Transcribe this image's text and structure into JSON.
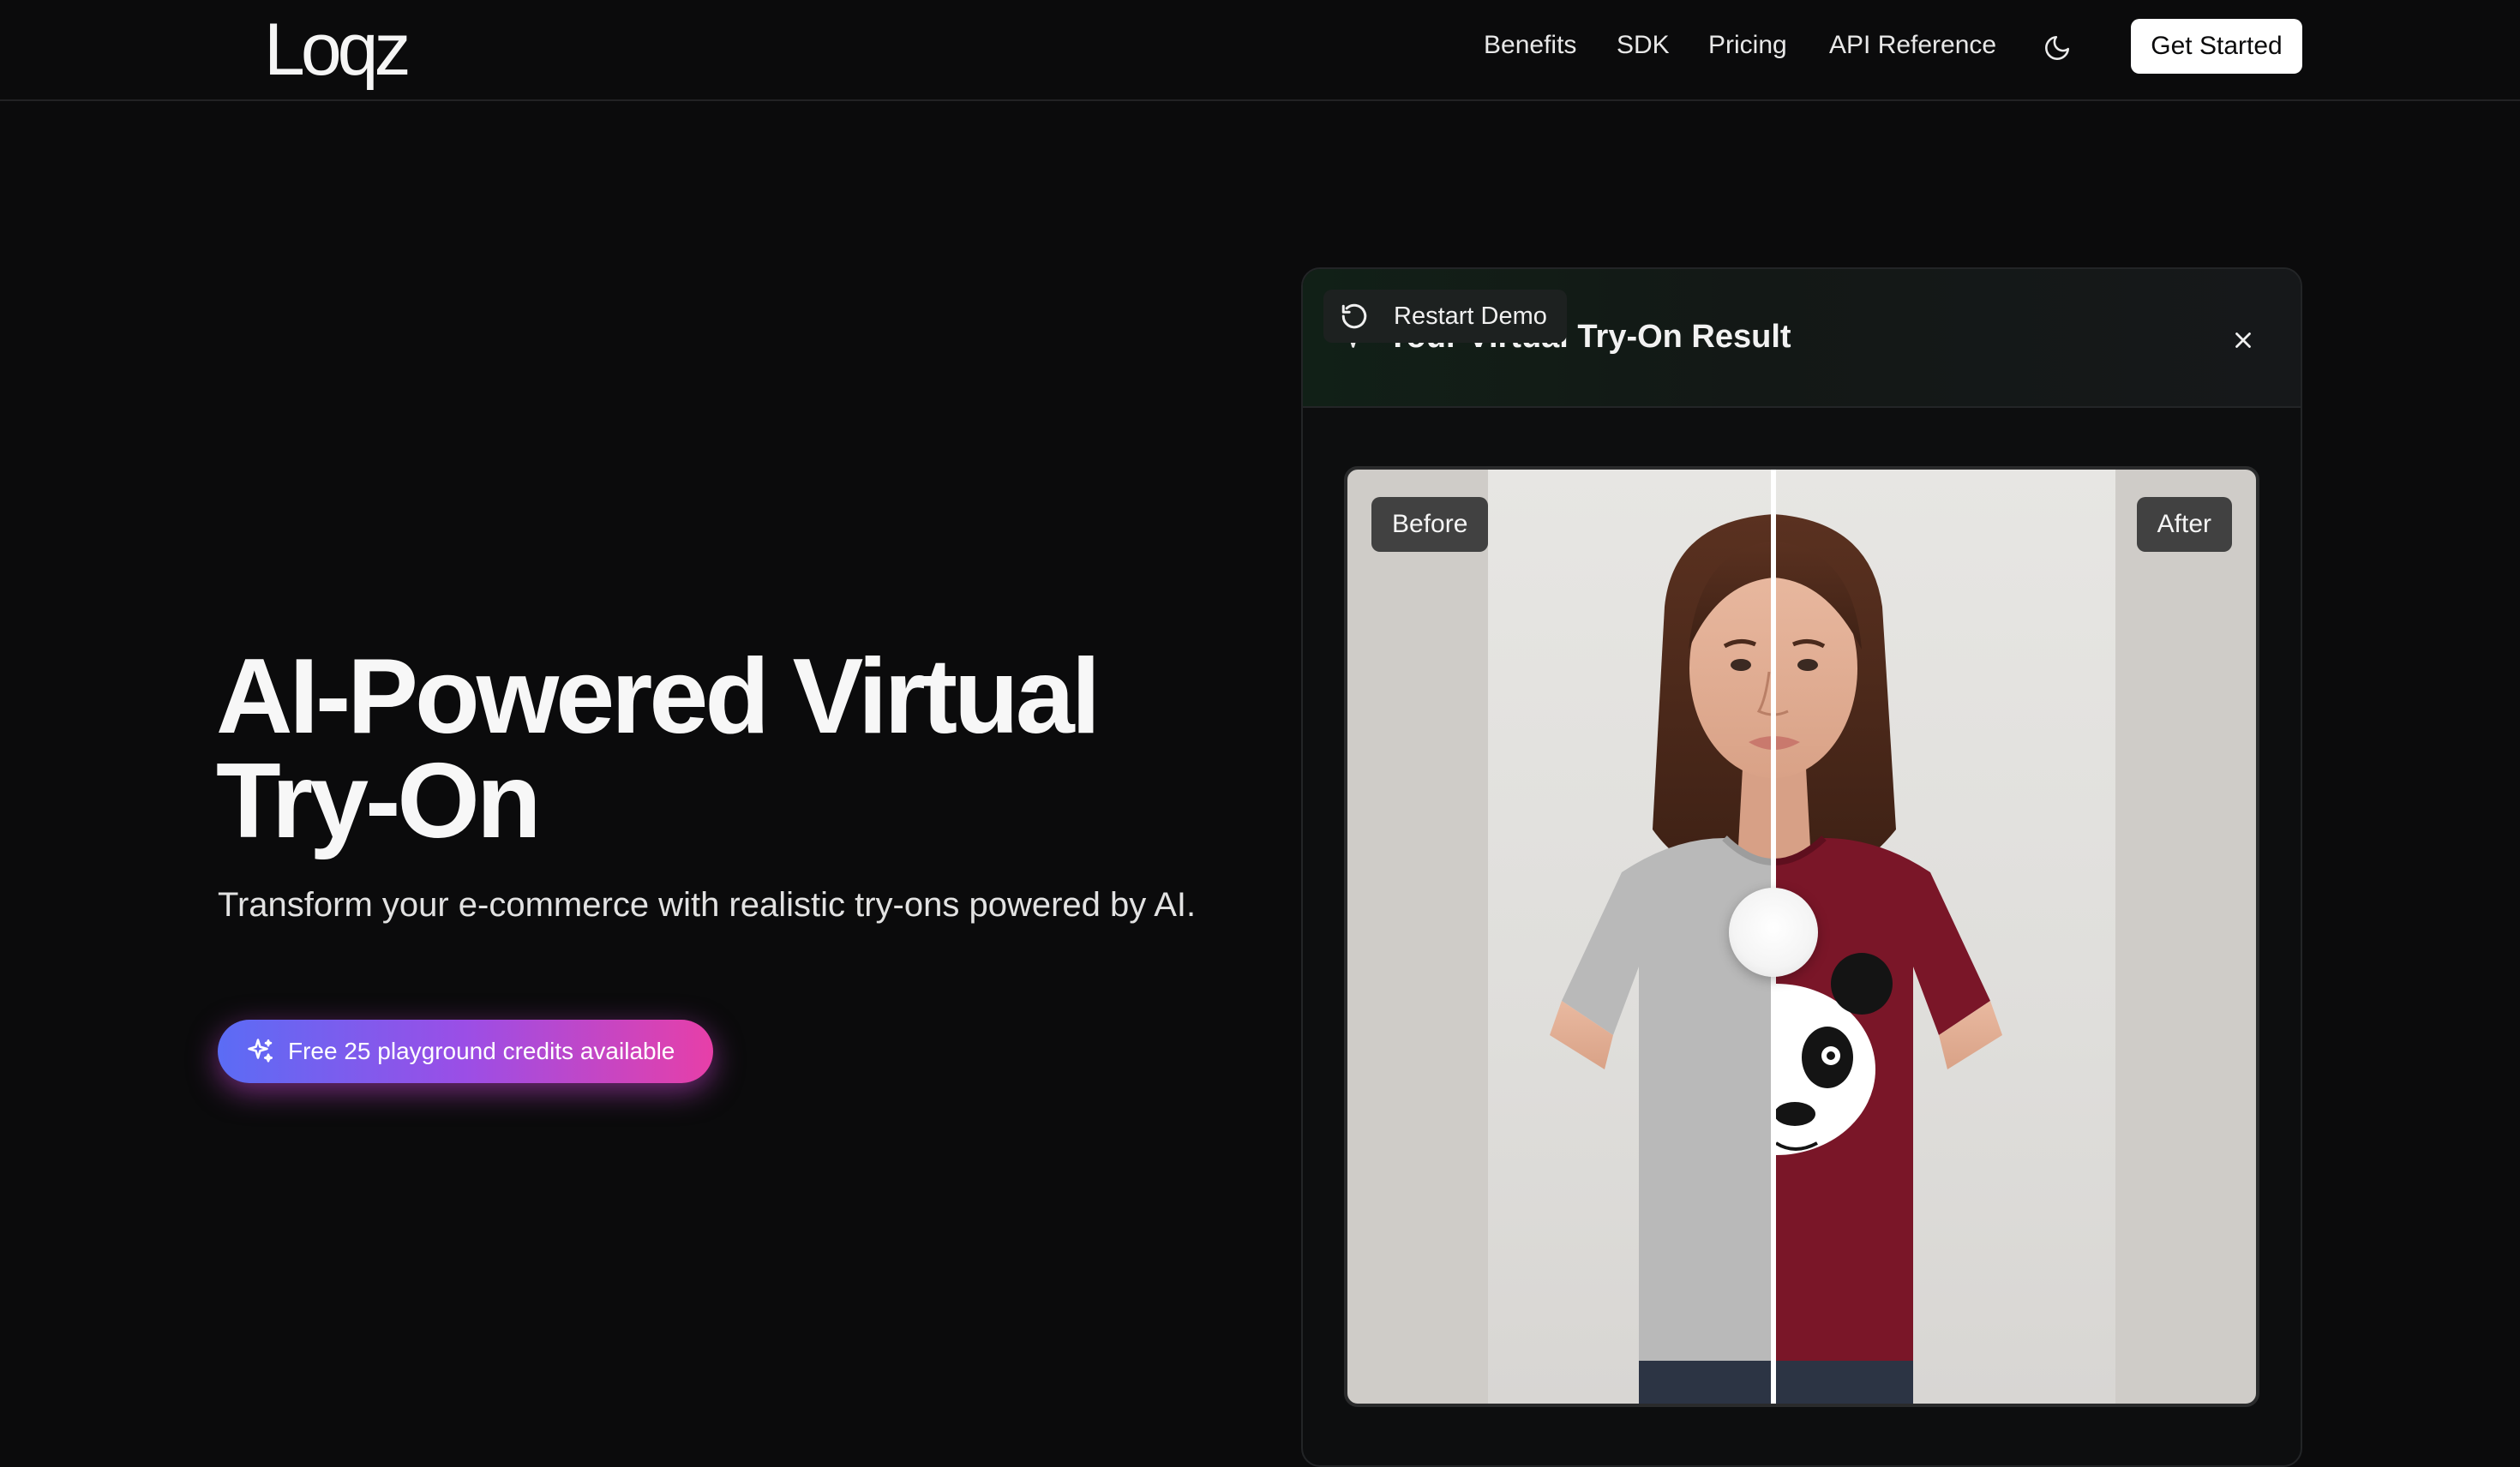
{
  "brand": {
    "logo_text": "Loqz"
  },
  "nav": {
    "links": [
      "Benefits",
      "SDK",
      "Pricing",
      "API Reference"
    ],
    "theme_icon": "moon-icon",
    "cta_label": "Get Started"
  },
  "hero": {
    "title_line1": "AI-Powered Virtual",
    "title_line2": "Try-On",
    "subtitle": "Transform your e-commerce with realistic try-ons powered by AI.",
    "credits_label": "Free 25 playground credits available",
    "credits_icon": "sparkle-icon",
    "credits_gradient": [
      "#5b6cf5",
      "#9b4ee6",
      "#e73fa8"
    ]
  },
  "demo": {
    "title": "Your Virtual Try-On Result",
    "title_icon": "sparkle-icon",
    "close_icon": "close-icon",
    "restart_label": "Restart Demo",
    "restart_icon": "restart-icon",
    "before_label": "Before",
    "after_label": "After",
    "before_shirt_color": "#b7b7b7",
    "after_shirt_color": "#7a1628"
  },
  "colors": {
    "background": "#0b0b0c",
    "header_border": "#222224",
    "card_border": "#232527"
  }
}
